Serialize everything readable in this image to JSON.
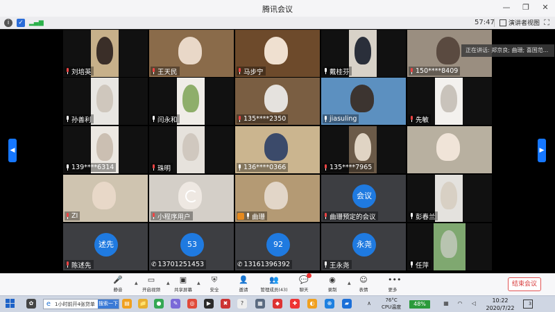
{
  "window": {
    "title": "腾讯会议"
  },
  "infobar": {
    "timer": "57:47",
    "speaker_view_label": "演讲者视图"
  },
  "notice": {
    "text": "正在讲话: 郑京良; 曲珊; 喜国范..."
  },
  "tiles": [
    {
      "name": "刘培英",
      "status": "muted"
    },
    {
      "name": "王天民",
      "status": "muted"
    },
    {
      "name": "马步宁",
      "status": "muted"
    },
    {
      "name": "戴桂芬",
      "status": "mic"
    },
    {
      "name": "150****8409",
      "status": "muted"
    },
    {
      "name": "孙善利",
      "status": "mic"
    },
    {
      "name": "闫永和",
      "status": "mic"
    },
    {
      "name": "135****2350",
      "status": "muted"
    },
    {
      "name": "jiasuling",
      "status": "mic"
    },
    {
      "name": "先敏",
      "status": "muted"
    },
    {
      "name": "139****6314",
      "status": "mic"
    },
    {
      "name": "珠明",
      "status": "muted"
    },
    {
      "name": "136****0366",
      "status": "mic"
    },
    {
      "name": "135****7965",
      "status": "muted"
    },
    {
      "name": "",
      "status": "none"
    },
    {
      "name": "ZI",
      "status": "muted"
    },
    {
      "name": "小程序用户",
      "status": "muted"
    },
    {
      "name": "曲珊",
      "status": "host"
    },
    {
      "name": "曲珊预定的会议",
      "status": "muted",
      "avatar": "会议"
    },
    {
      "name": "彭春兰",
      "status": "mic"
    },
    {
      "name": "陈述先",
      "status": "muted",
      "avatar": "述先"
    },
    {
      "name": "13701251453",
      "status": "phone",
      "avatar": "53"
    },
    {
      "name": "13161396392",
      "status": "phone",
      "avatar": "92"
    },
    {
      "name": "王永尧",
      "status": "mic",
      "avatar": "永尧"
    },
    {
      "name": "任萍",
      "status": "mic"
    }
  ],
  "toolbar": {
    "mute": "静音",
    "video": "开启视频",
    "share": "共享屏幕",
    "security": "安全",
    "invite": "邀请",
    "members": "管理成员(43)",
    "chat": "聊天",
    "record": "录制",
    "reactions": "表情",
    "more": "更多",
    "end": "结束会议"
  },
  "taskbar": {
    "search_text": "1小时前开4张贷单",
    "search_button": "搜索一下",
    "temp_value": "76°C",
    "temp_label": "CPU温度",
    "battery": "48%",
    "time": "10:22",
    "date": "2020/7/22",
    "notif_count": "3"
  },
  "colors": {
    "accent": "#1677ff",
    "end": "#d73a3a",
    "avatar_tile": "#3d3e42"
  }
}
